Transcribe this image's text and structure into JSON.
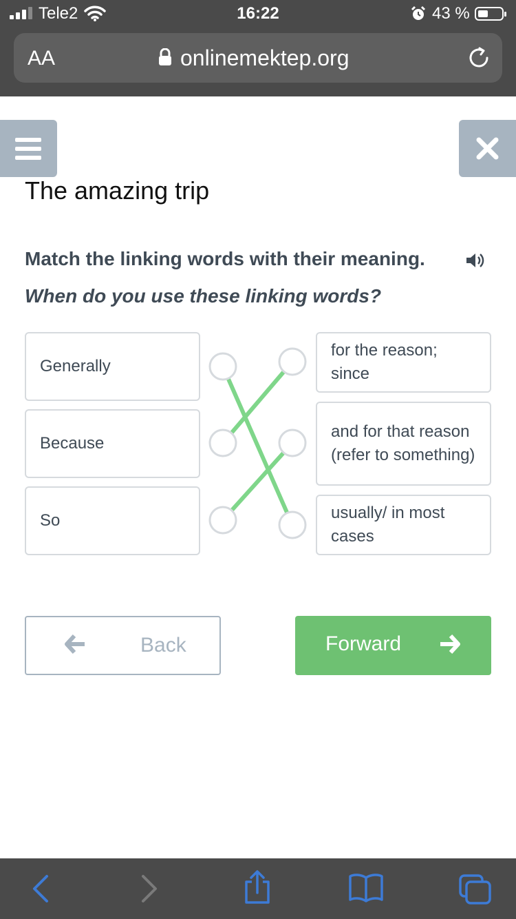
{
  "status": {
    "carrier": "Tele2",
    "time": "16:22",
    "battery": "43 %"
  },
  "browser": {
    "text_size_label": "AA",
    "url": "onlinemektep.org"
  },
  "page": {
    "title": "The amazing trip",
    "instruction": "Match the linking words with their meaning.",
    "question": "When do you use these linking words?"
  },
  "match": {
    "left": [
      "Generally",
      "Because",
      "So"
    ],
    "right": [
      "for the reason; since",
      "and for that reason (refer to something)",
      "usually/ in most cases"
    ],
    "connections": [
      [
        0,
        2
      ],
      [
        1,
        0
      ],
      [
        2,
        1
      ]
    ],
    "line_color": "#7fd68a"
  },
  "nav": {
    "back_label": "Back",
    "forward_label": "Forward"
  },
  "colors": {
    "accent_green": "#6ec172",
    "muted_blue_gray": "#a7b4c0",
    "text_dark": "#3f4a55",
    "browser_chrome": "#4a4a4a",
    "toolbar_icon_blue": "#3d7bd6"
  },
  "icons": [
    "signal-icon",
    "wifi-icon",
    "alarm-icon",
    "battery-icon",
    "lock-icon",
    "reload-icon",
    "menu-icon",
    "close-icon",
    "speaker-icon",
    "arrow-left-icon",
    "arrow-right-icon",
    "nav-back-icon",
    "nav-forward-icon",
    "share-icon",
    "bookmarks-icon",
    "tabs-icon"
  ]
}
